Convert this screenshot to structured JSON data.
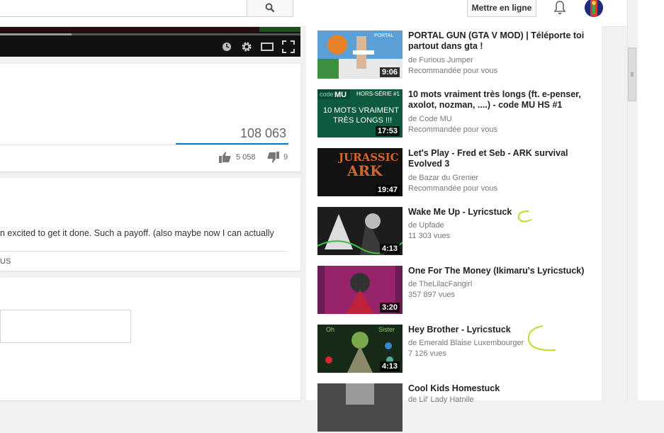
{
  "header": {
    "upload_label": "Mettre en ligne"
  },
  "video": {
    "views": "108 063",
    "likes": "5 058",
    "dislikes": "9"
  },
  "description": {
    "text": "n excited to get it done. Such a payoff. (also maybe now I can actually",
    "show_more": "US"
  },
  "related": [
    {
      "title": "PORTAL GUN (GTA V MOD) | Téléporte toi partout dans gta !",
      "channel": "de Furious Jumper",
      "meta": "Recommandée pour vous",
      "duration": "9:06",
      "colors": [
        "#4a8fc4",
        "#d98a2b"
      ]
    },
    {
      "title": "10 mots vraiment très longs (ft. e-penser, axolot, nozman, ....) - code MU HS #1",
      "channel": "de Code MU",
      "meta": "Recommandée pour vous",
      "duration": "17:53",
      "thumb_text": [
        "HORS-SÉRIE #1",
        "10 MOTS VRAIMENT",
        "TRÈS LONGS !!!"
      ],
      "colors": [
        "#0f5b40",
        "#1d7a55"
      ]
    },
    {
      "title": "Let's Play - Fred et Seb - ARK survival Evolved 3",
      "channel": "de Bazar du Grenier",
      "meta": "Recommandée pour vous",
      "duration": "19:47",
      "thumb_text": [
        "JURASSIC",
        "ARK"
      ],
      "colors": [
        "#1a1a1a",
        "#b8431a"
      ]
    },
    {
      "title": "Wake Me Up - Lyricstuck",
      "channel": "de Upfade",
      "meta": "11 303 vues",
      "duration": "4:13",
      "colors": [
        "#2a2a2a",
        "#3fa842"
      ]
    },
    {
      "title": "One For The Money (Ikimaru's Lyricstuck)",
      "channel": "de TheLilacFangirl",
      "meta": "357 897 vues",
      "duration": "3:20",
      "colors": [
        "#6a1f4f",
        "#c0296a"
      ]
    },
    {
      "title": "Hey Brother - Lyricstuck",
      "channel": "de Emerald Blaise Luxembourger",
      "meta": "7 126 vues",
      "duration": "4:13",
      "thumb_text": [
        "Oh",
        "Sister"
      ],
      "colors": [
        "#1c2e1c",
        "#7aa84a"
      ]
    },
    {
      "title": "Cool Kids Homestuck",
      "channel": "de Lil' Lady Hatnile",
      "meta": "",
      "duration": "",
      "colors": [
        "#555",
        "#aaa"
      ]
    }
  ]
}
